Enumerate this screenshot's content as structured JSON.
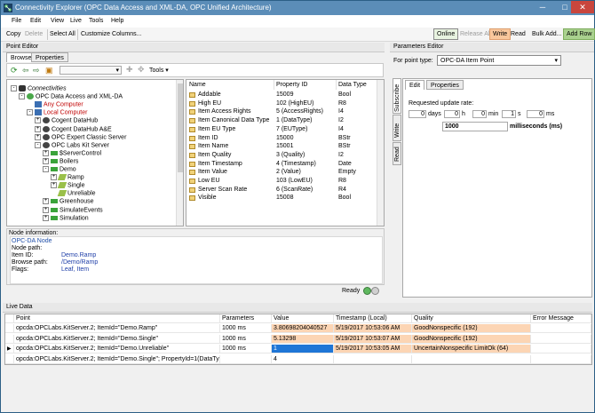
{
  "window": {
    "title": "Connectivity Explorer (OPC Data Access and XML-DA, OPC Unified Architecture)",
    "min_glyph": "─",
    "max_glyph": "□",
    "close_glyph": "✕"
  },
  "menu": [
    "File",
    "Edit",
    "View",
    "Live",
    "Tools",
    "Help"
  ],
  "toolbar": {
    "copy": "Copy",
    "delete": "Delete",
    "select_all": "Select All",
    "customize": "Customize Columns...",
    "online": "Online",
    "release_all": "Release All",
    "write": "Write",
    "read": "Read",
    "bulk_add": "Bulk Add...",
    "add_row": "Add Row"
  },
  "point_editor": {
    "header": "Point Editor",
    "tabs": [
      "Browse",
      "Properties"
    ],
    "tools_label": "Tools",
    "tree": [
      {
        "label": "Connectivities",
        "level": 0,
        "exp": "-",
        "style": "italic"
      },
      {
        "label": "OPC Data Access and XML-DA",
        "level": 1,
        "exp": "-"
      },
      {
        "label": "Any Computer",
        "level": 2,
        "exp": "",
        "style": "red"
      },
      {
        "label": "Local Computer",
        "level": 2,
        "exp": "-",
        "style": "red"
      },
      {
        "label": "Cogent DataHub",
        "level": 3,
        "exp": "+"
      },
      {
        "label": "Cogent DataHub A&E",
        "level": 3,
        "exp": "+"
      },
      {
        "label": "OPC Expert Classic Server",
        "level": 3,
        "exp": "+"
      },
      {
        "label": "OPC Labs Kit Server",
        "level": 3,
        "exp": "-"
      },
      {
        "label": "$ServerControl",
        "level": 4,
        "exp": "+"
      },
      {
        "label": "Boilers",
        "level": 4,
        "exp": "+"
      },
      {
        "label": "Demo",
        "level": 4,
        "exp": "-"
      },
      {
        "label": "Ramp",
        "level": 5,
        "exp": "+"
      },
      {
        "label": "Single",
        "level": 5,
        "exp": "+"
      },
      {
        "label": "Unreliable",
        "level": 5,
        "exp": ""
      },
      {
        "label": "Greenhouse",
        "level": 4,
        "exp": "+"
      },
      {
        "label": "SimulateEvents",
        "level": 4,
        "exp": "+"
      },
      {
        "label": "Simulation",
        "level": 4,
        "exp": "+"
      }
    ],
    "columns": [
      "Name",
      "Property ID",
      "Data Type"
    ],
    "properties": [
      [
        "Addable",
        "15009",
        "Bool"
      ],
      [
        "High EU",
        "102 (HighEU)",
        "R8"
      ],
      [
        "Item Access Rights",
        "5 (AccessRights)",
        "I4"
      ],
      [
        "Item Canonical Data Type",
        "1 (DataType)",
        "I2"
      ],
      [
        "Item EU Type",
        "7 (EUType)",
        "I4"
      ],
      [
        "Item ID",
        "15000",
        "BStr"
      ],
      [
        "Item Name",
        "15001",
        "BStr"
      ],
      [
        "Item Quality",
        "3 (Quality)",
        "I2"
      ],
      [
        "Item Timestamp",
        "4 (Timestamp)",
        "Date"
      ],
      [
        "Item Value",
        "2 (Value)",
        "Empty"
      ],
      [
        "Low EU",
        "103 (LowEU)",
        "R8"
      ],
      [
        "Server Scan Rate",
        "6 (ScanRate)",
        "R4"
      ],
      [
        "Visible",
        "15008",
        "Bool"
      ]
    ],
    "node_info": {
      "title": "Node information:",
      "heading": "OPC-DA Node",
      "node_path_label": "Node path:",
      "item_id_label": "Item ID:",
      "item_id": "Demo.Ramp",
      "browse_path_label": "Browse path:",
      "browse_path": "/Demo/Ramp",
      "flags_label": "Flags:",
      "flags": "Leaf, Item"
    },
    "status": "Ready"
  },
  "parameters_editor": {
    "header": "Parameters Editor",
    "point_type_label": "For point type:",
    "point_type": "OPC-DA Item Point",
    "side_tabs": [
      "Subscribe",
      "Write",
      "Read"
    ],
    "tabs": [
      "Edit",
      "Properties"
    ],
    "update_rate_label": "Requested update rate:",
    "days": "0",
    "days_unit": "days",
    "hours": "0",
    "hours_unit": "h",
    "mins": "0",
    "mins_unit": "min",
    "secs": "1",
    "secs_unit": "s",
    "ms": "0",
    "ms_unit": "ms",
    "ms_total": "1000",
    "ms_total_unit": "milliseconds (ms)"
  },
  "live_data": {
    "header": "Live Data",
    "columns": [
      "Point",
      "Parameters",
      "Value",
      "Timestamp (Local)",
      "Quality",
      "Error Message"
    ],
    "rows": [
      {
        "point": "opcda:OPCLabs.KitServer.2; ItemId=\"Demo.Ramp\"",
        "params": "1000 ms",
        "value": "3.80698204040527",
        "timestamp": "5/19/2017 10:53:06 AM",
        "quality": "GoodNonspecific (192)",
        "error": ""
      },
      {
        "point": "opcda:OPCLabs.KitServer.2; ItemId=\"Demo.Single\"",
        "params": "1000 ms",
        "value": "5.13298",
        "timestamp": "5/19/2017 10:53:07 AM",
        "quality": "GoodNonspecific (192)",
        "error": ""
      },
      {
        "point": "opcda:OPCLabs.KitServer.2; ItemId=\"Demo.Unreliable\"",
        "params": "1000 ms",
        "value": "1",
        "timestamp": "5/19/2017 10:53:05 AM",
        "quality": "UncertainNonspecific LimitOk (64)",
        "error": ""
      },
      {
        "point": "opcda:OPCLabs.KitServer.2; ItemId=\"Demo.Single\"; PropertyId=1(DataType)",
        "params": "",
        "value": "4",
        "timestamp": "",
        "quality": "",
        "error": ""
      }
    ]
  },
  "icons": {
    "dropdown": "▾",
    "row_selector": "▶"
  },
  "colors": {
    "title_bar": "#5b8db8",
    "good_quality": "#fcd5b4",
    "selected": "#1f76d6",
    "write_button": "#f9c79c",
    "add_row_button": "#a9d18e",
    "online_button": "#e8f3e0"
  }
}
